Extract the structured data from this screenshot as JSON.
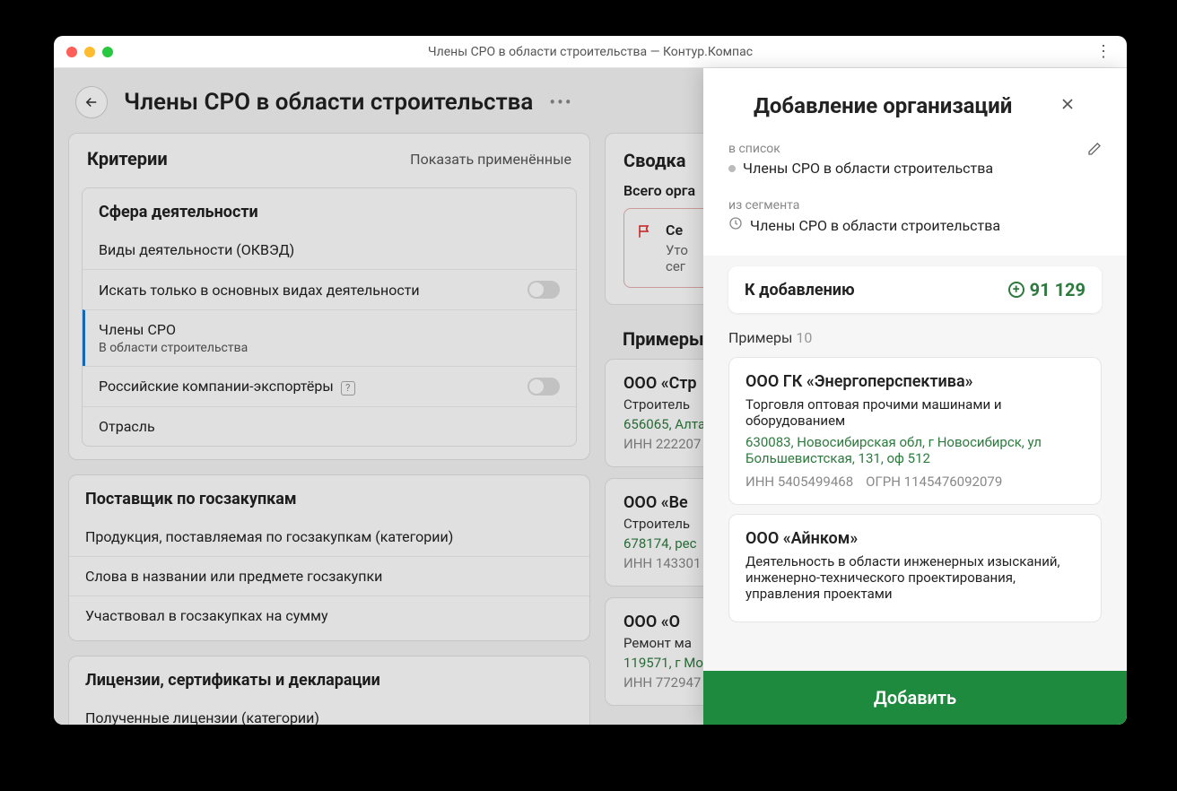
{
  "window": {
    "title": "Члены СРО в области строительства — Контур.Компас"
  },
  "page": {
    "title": "Члены СРО в области строительства"
  },
  "criteria": {
    "title": "Критерии",
    "show_applied": "Показать применённые",
    "groups": [
      {
        "title": "Сфера деятельности",
        "rows": [
          {
            "label": "Виды деятельности (ОКВЭД)"
          },
          {
            "label": "Искать только в основных видах деятельности",
            "toggle": true
          },
          {
            "label": "Члены СРО",
            "sub": "В области строительства",
            "active": true
          },
          {
            "label": "Российские компании-экспортёры",
            "help": true,
            "toggle": true
          },
          {
            "label": "Отрасль"
          }
        ]
      },
      {
        "title": "Поставщик по госзакупкам",
        "rows": [
          {
            "label": "Продукция, поставляемая по госзакупкам (категории)"
          },
          {
            "label": "Слова в названии или предмете госзакупки"
          },
          {
            "label": "Участвовал в госзакупках на сумму"
          }
        ]
      },
      {
        "title": "Лицензии, сертификаты и декларации",
        "rows": [
          {
            "label": "Полученные лицензии (категории)"
          }
        ]
      }
    ]
  },
  "summary": {
    "title": "Сводка",
    "total_label": "Всего орга",
    "alert_title": "Се",
    "alert_sub1": "Уто",
    "alert_sub2": "сег"
  },
  "examples": {
    "title": "Примеры",
    "items": [
      {
        "name": "ООО «Стр",
        "desc": "Строитель",
        "addr": "656065, Алта",
        "inn": "ИНН 222207"
      },
      {
        "name": "ООО «Ве",
        "desc": "Строитель",
        "addr": "678174, рес",
        "inn": "ИНН 143301"
      },
      {
        "name": "ООО «О",
        "desc": "Ремонт ма",
        "addr": "119571, г Мо",
        "inn": "ИНН 772947"
      }
    ]
  },
  "panel": {
    "title": "Добавление организаций",
    "to_list_label": "в список",
    "list_name": "Члены СРО в области строительства",
    "from_segment_label": "из сегмента",
    "segment_name": "Члены СРО в области строительства",
    "to_add_label": "К добавлению",
    "to_add_count": "91 129",
    "examples_label": "Примеры",
    "examples_count": "10",
    "examples": [
      {
        "name": "ООО ГК «Энергоперспектива»",
        "desc": "Торговля оптовая прочими машинами и оборудованием",
        "addr": "630083, Новосибирская обл, г Новосибирск, ул Большевистская, 131, оф 512",
        "inn": "ИНН 5405499468",
        "ogrn": "ОГРН 1145476092079"
      },
      {
        "name": "ООО «Айнком»",
        "desc": "Деятельность в области инженерных изысканий, инженерно-технического проектирования, управления проектами"
      }
    ],
    "add_button": "Добавить"
  }
}
